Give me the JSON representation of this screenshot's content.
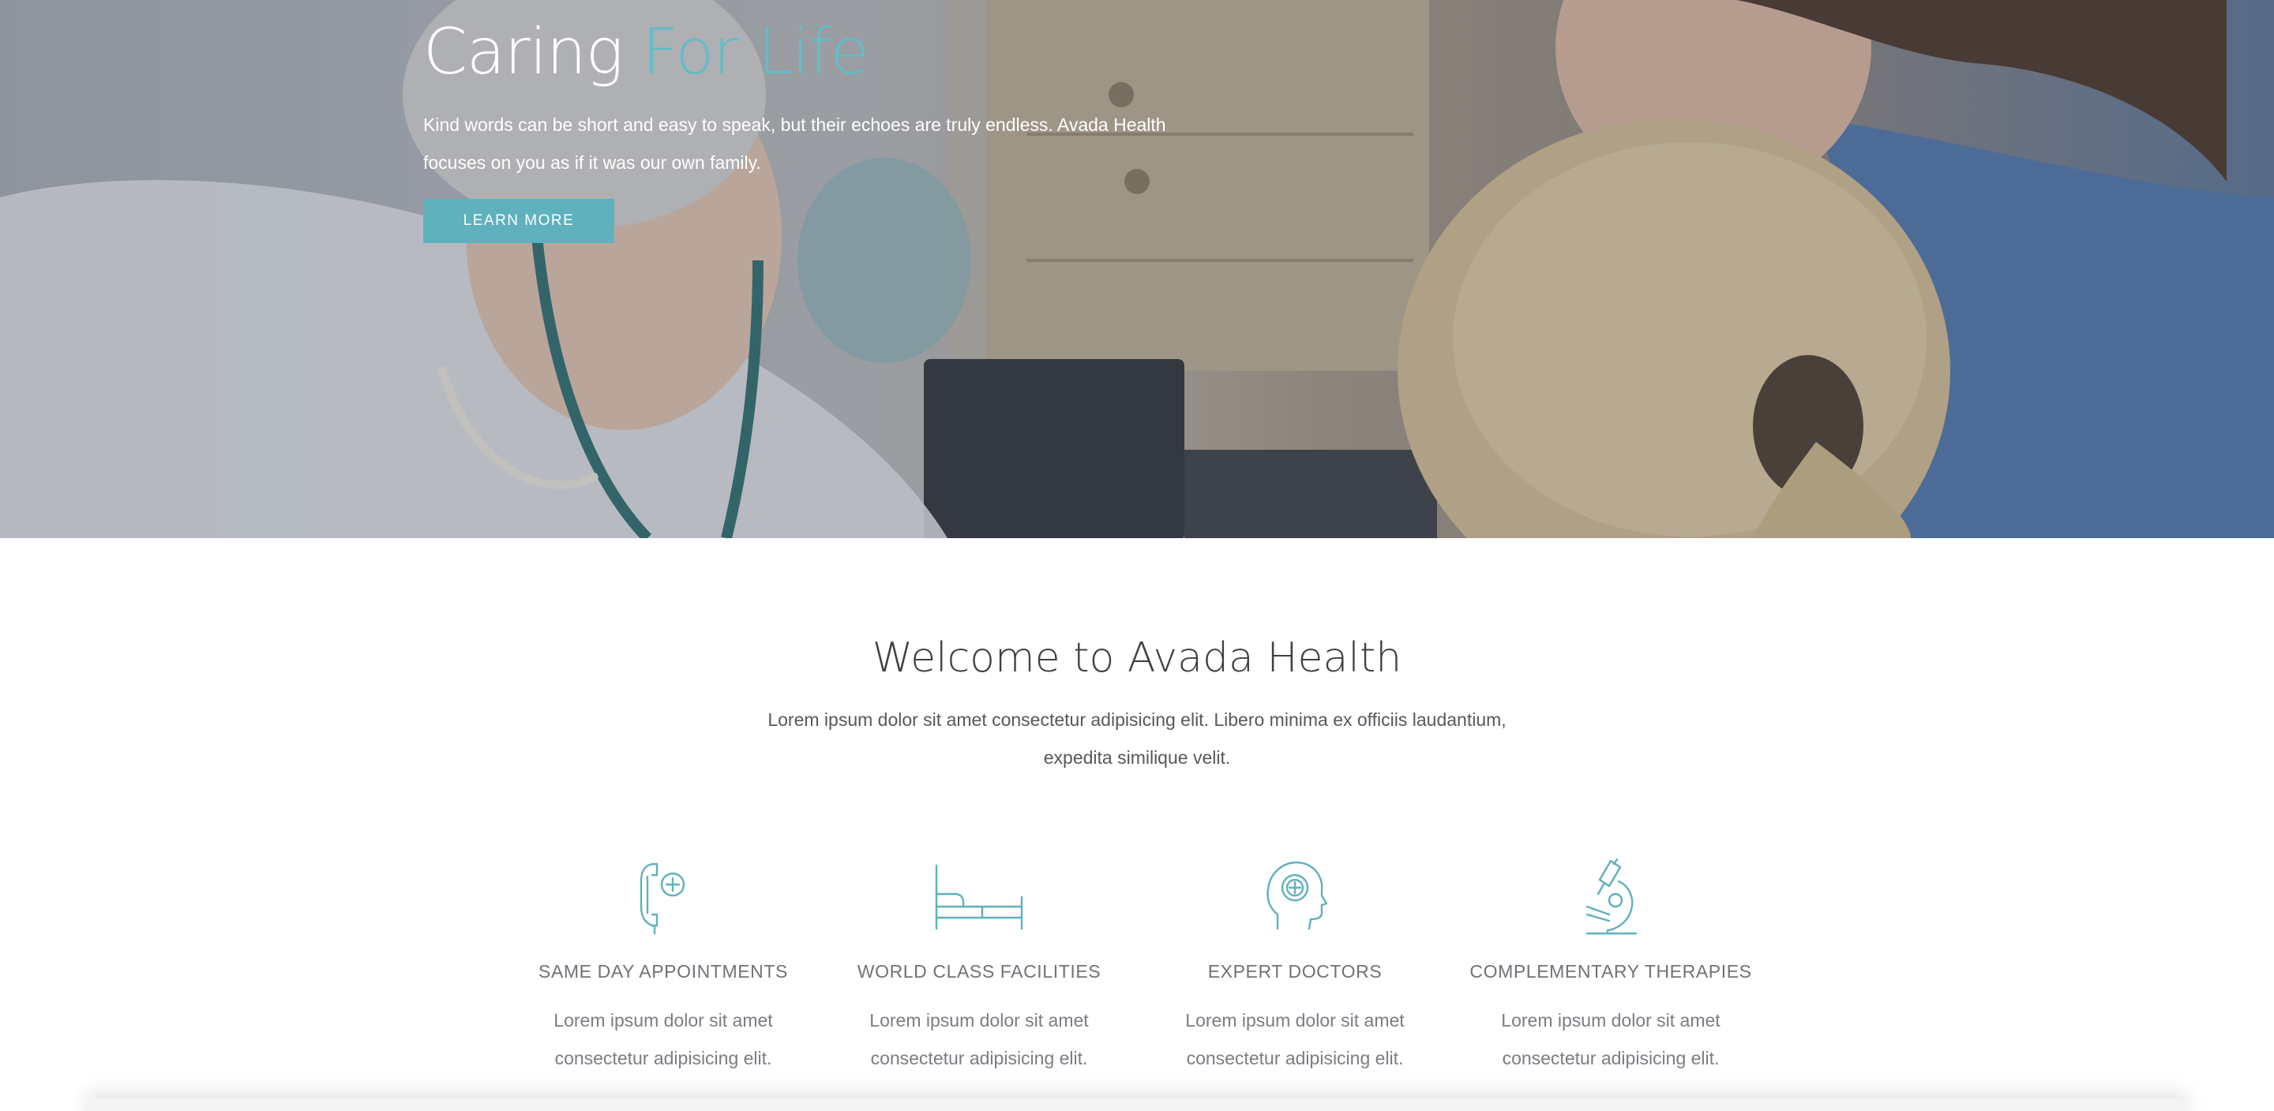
{
  "hero": {
    "title_main": "Caring",
    "title_accent": "For Life",
    "text": "Kind words can be short and easy to speak, but their echoes are truly endless. Avada Health focuses on you as if it was our own family.",
    "button_label": "LEARN MORE"
  },
  "welcome": {
    "title": "Welcome to Avada Health",
    "text": "Lorem ipsum dolor sit amet consectetur adipisicing elit. Libero minima ex officiis laudantium, expedita similique velit."
  },
  "features": [
    {
      "icon": "phone-plus-icon",
      "title": "SAME DAY APPOINTMENTS",
      "text": "Lorem ipsum dolor sit amet consectetur adipisicing elit."
    },
    {
      "icon": "bed-icon",
      "title": "WORLD CLASS FACILITIES",
      "text": "Lorem ipsum dolor sit amet consectetur adipisicing elit."
    },
    {
      "icon": "head-plus-icon",
      "title": "EXPERT DOCTORS",
      "text": "Lorem ipsum dolor sit amet consectetur adipisicing elit."
    },
    {
      "icon": "microscope-icon",
      "title": "COMPLEMENTARY THERAPIES",
      "text": "Lorem ipsum dolor sit amet consectetur adipisicing elit."
    }
  ],
  "colors": {
    "accent": "#65bcc7",
    "button": "#5fb1bd",
    "icon": "#5fb1bd",
    "heading": "#3e4045"
  }
}
